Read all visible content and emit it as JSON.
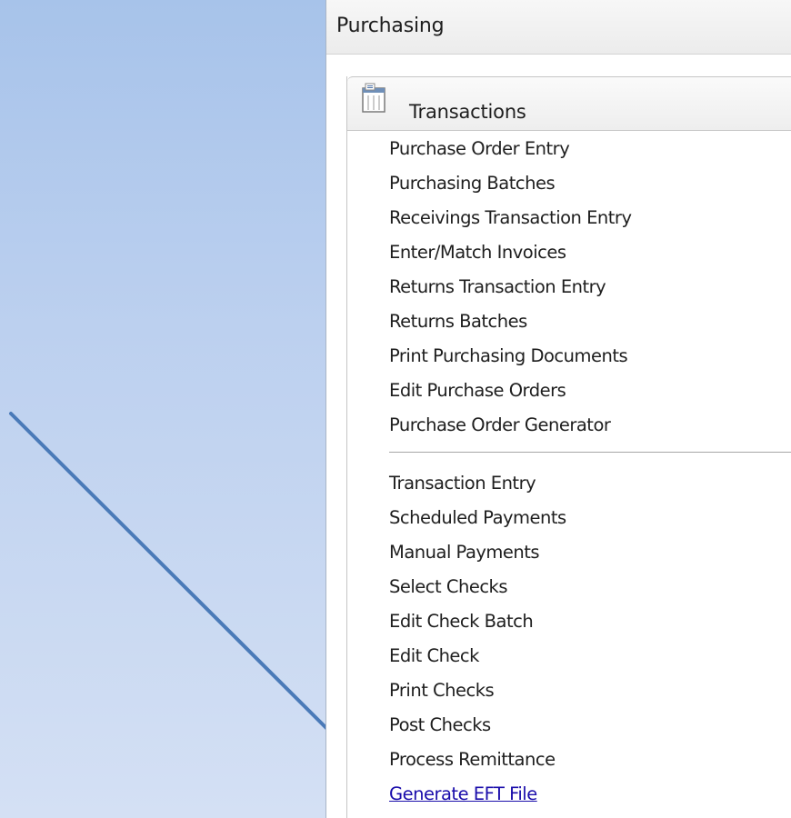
{
  "pane": {
    "title": "Purchasing"
  },
  "section": {
    "title": "Transactions",
    "icon": "document-list-icon"
  },
  "groups": [
    {
      "items": [
        {
          "label": "Purchase Order Entry"
        },
        {
          "label": "Purchasing Batches"
        },
        {
          "label": "Receivings Transaction Entry"
        },
        {
          "label": "Enter/Match Invoices"
        },
        {
          "label": "Returns Transaction Entry"
        },
        {
          "label": "Returns Batches"
        },
        {
          "label": "Print Purchasing Documents"
        },
        {
          "label": "Edit Purchase Orders"
        },
        {
          "label": "Purchase Order Generator"
        }
      ]
    },
    {
      "items": [
        {
          "label": "Transaction Entry"
        },
        {
          "label": "Scheduled Payments"
        },
        {
          "label": "Manual Payments"
        },
        {
          "label": "Select Checks"
        },
        {
          "label": "Edit Check Batch"
        },
        {
          "label": "Edit Check"
        },
        {
          "label": "Print Checks"
        },
        {
          "label": "Post Checks"
        },
        {
          "label": "Process Remittance"
        },
        {
          "label": "Generate EFT File",
          "highlighted": true
        }
      ]
    }
  ],
  "colors": {
    "link": "#1a0dab",
    "arrow": "#4a7ab8",
    "background": "#b4cbee"
  }
}
